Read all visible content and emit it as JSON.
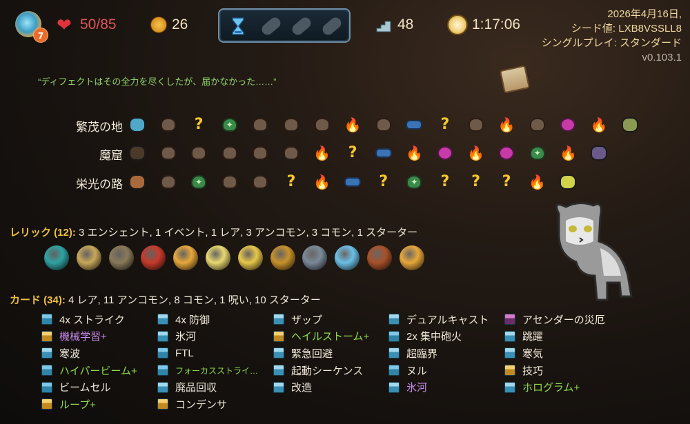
{
  "header": {
    "ascension": "7",
    "hp": "50/85",
    "gold": "26",
    "floor": "48",
    "time": "1:17:06",
    "info": {
      "date": "2026年4月16日,",
      "seed": "シード値: LXB8VSSLL8",
      "mode": "シングルプレイ: スタンダード",
      "version": "v0.103.1"
    }
  },
  "quote": "“ディフェクトはその全力を尽くしたが、届かなかった……”",
  "acts": [
    {
      "label": "繁茂の地",
      "nodes": [
        "boss-blue",
        "monster",
        "unknown",
        "rest",
        "monster",
        "monster",
        "monster",
        "elite",
        "monster",
        "shop",
        "bossq",
        "monster",
        "elite",
        "monster",
        "event",
        "elite",
        "boss-gold"
      ]
    },
    {
      "label": "魔窟",
      "nodes": [
        "boss-dark",
        "monster",
        "monster",
        "monster",
        "monster",
        "monster",
        "elite",
        "unknown",
        "shop",
        "elite",
        "event",
        "elite",
        "event",
        "rest",
        "elite",
        "boss-purple"
      ]
    },
    {
      "label": "栄光の路",
      "nodes": [
        "boss-lion",
        "monster",
        "rest",
        "monster",
        "monster",
        "unknown",
        "elite",
        "shop",
        "unknown",
        "rest",
        "unknown",
        "bossq",
        "unknown",
        "elite",
        "boss-snake"
      ]
    }
  ],
  "relics": {
    "key": "レリック (12):",
    "summary": "3 エンシェント, 1 イベント, 1 レア, 3 アンコモン, 3 コモン, 1 スターター",
    "items": [
      "teal-orb-icon",
      "golden-tablet-icon",
      "sickle-icon",
      "drum-icon",
      "gold-coin-relic-icon",
      "pear-icon",
      "feather-icon",
      "crown-icon",
      "trident-icon",
      "spirit-icon",
      "crate-icon",
      "sunflower-pot-icon"
    ]
  },
  "cards": {
    "key": "カード (34):",
    "summary": "4 レア, 11 アンコモン, 8 コモン, 1 呪い, 10 スターター",
    "columns": [
      [
        {
          "name": "4x ストライク",
          "style": "normal",
          "icon": "attack"
        },
        {
          "name": "機械学習+",
          "style": "trans",
          "icon": "power"
        },
        {
          "name": "寒波",
          "style": "normal",
          "icon": "skill"
        },
        {
          "name": "ハイパービーム+",
          "style": "up",
          "icon": "attack"
        },
        {
          "name": "ビームセル",
          "style": "normal",
          "icon": "attack"
        },
        {
          "name": "ループ+",
          "style": "up",
          "icon": "power"
        }
      ],
      [
        {
          "name": "4x 防御",
          "style": "normal",
          "icon": "skill"
        },
        {
          "name": "氷河",
          "style": "normal",
          "icon": "skill"
        },
        {
          "name": "FTL",
          "style": "normal",
          "icon": "attack"
        },
        {
          "name": "フォーカスストライ…",
          "style": "up-small",
          "icon": "attack"
        },
        {
          "name": "廃品回収",
          "style": "normal",
          "icon": "skill"
        },
        {
          "name": "コンデンサ",
          "style": "normal",
          "icon": "power"
        }
      ],
      [
        {
          "name": "ザップ",
          "style": "normal",
          "icon": "skill"
        },
        {
          "name": "ヘイルストーム+",
          "style": "up",
          "icon": "power"
        },
        {
          "name": "緊急回避",
          "style": "normal",
          "icon": "skill"
        },
        {
          "name": "起動シーケンス",
          "style": "normal",
          "icon": "skill"
        },
        {
          "name": "改造",
          "style": "normal",
          "icon": "skill"
        }
      ],
      [
        {
          "name": "デュアルキャスト",
          "style": "normal",
          "icon": "skill"
        },
        {
          "name": "2x 集中砲火",
          "style": "normal",
          "icon": "attack"
        },
        {
          "name": "超臨界",
          "style": "normal",
          "icon": "skill"
        },
        {
          "name": "ヌル",
          "style": "normal",
          "icon": "attack"
        },
        {
          "name": "氷河",
          "style": "trans",
          "icon": "skill"
        }
      ],
      [
        {
          "name": "アセンダーの災厄",
          "style": "normal",
          "icon": "curse"
        },
        {
          "name": "跳躍",
          "style": "normal",
          "icon": "skill"
        },
        {
          "name": "寒気",
          "style": "normal",
          "icon": "skill"
        },
        {
          "name": "技巧",
          "style": "normal",
          "icon": "power"
        },
        {
          "name": "ホログラム+",
          "style": "up",
          "icon": "skill"
        }
      ]
    ]
  },
  "colors": {
    "hp": "#e0555a",
    "upgraded": "#8fdc4a",
    "transformed": "#c98ae8",
    "section_key": "#f0c040",
    "info_text": "#f0d8a0"
  }
}
